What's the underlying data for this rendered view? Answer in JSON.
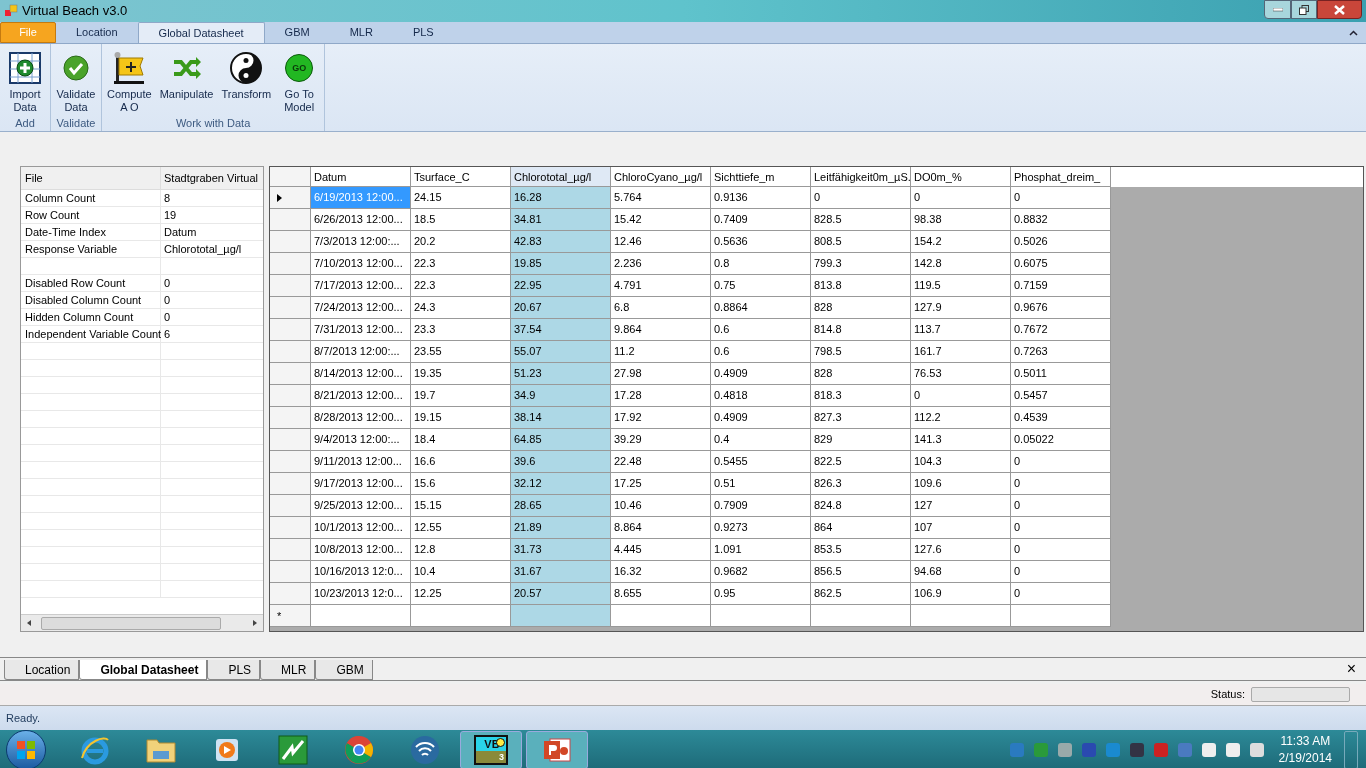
{
  "window": {
    "title": "Virtual Beach v3.0"
  },
  "ribbon_tabs": [
    {
      "label": "File",
      "kind": "file",
      "selected": false
    },
    {
      "label": "Location",
      "kind": "tab",
      "selected": false
    },
    {
      "label": "Global Datasheet",
      "kind": "tab",
      "selected": true
    },
    {
      "label": "GBM",
      "kind": "tab",
      "selected": false
    },
    {
      "label": "MLR",
      "kind": "tab",
      "selected": false
    },
    {
      "label": "PLS",
      "kind": "tab",
      "selected": false
    }
  ],
  "ribbon_groups": [
    {
      "label": "Add",
      "buttons": [
        {
          "label": "Import\nData",
          "kind": "import"
        }
      ]
    },
    {
      "label": "Validate",
      "buttons": [
        {
          "label": "Validate\nData",
          "kind": "validate"
        }
      ]
    },
    {
      "label": "Work with Data",
      "buttons": [
        {
          "label": "Compute\nA O",
          "kind": "compute"
        },
        {
          "label": "Manipulate",
          "kind": "shuffle"
        },
        {
          "label": "Transform",
          "kind": "yinyang"
        },
        {
          "label": "Go To\nModel",
          "kind": "go",
          "icon_text": "GO"
        }
      ]
    }
  ],
  "properties": {
    "header": [
      "File",
      "Stadtgraben Virtual"
    ],
    "rows": [
      [
        "Column Count",
        "8"
      ],
      [
        "Row Count",
        "19"
      ],
      [
        "Date-Time Index",
        "Datum"
      ],
      [
        "Response Variable",
        "Chlorototal_µg/l"
      ],
      [],
      [
        "Disabled Row Count",
        "0"
      ],
      [
        "Disabled Column Count",
        "0"
      ],
      [
        "Hidden Column Count",
        "0"
      ],
      [
        "Independent Variable Count",
        "6"
      ]
    ]
  },
  "table": {
    "columns": [
      {
        "label": "Datum",
        "selected": false
      },
      {
        "label": "Tsurface_C",
        "selected": false
      },
      {
        "label": "Chlorototal_µg/l",
        "selected": true
      },
      {
        "label": "ChloroCyano_µg/l",
        "selected": false
      },
      {
        "label": "Sichttiefe_m",
        "selected": false
      },
      {
        "label": "Leitfähigkeit0m_µS.",
        "selected": false
      },
      {
        "label": "DO0m_%",
        "selected": false
      },
      {
        "label": "Phosphat_dreim_",
        "selected": false
      }
    ],
    "rows": [
      {
        "current": true,
        "cells": [
          "6/19/2013 12:00...",
          "24.15",
          "16.28",
          "5.764",
          "0.9136",
          "0",
          "0",
          "0"
        ],
        "date_selected": true
      },
      {
        "current": false,
        "cells": [
          "6/26/2013 12:00...",
          "18.5",
          "34.81",
          "15.42",
          "0.7409",
          "828.5",
          "98.38",
          "0.8832"
        ]
      },
      {
        "current": false,
        "cells": [
          "7/3/2013 12:00:...",
          "20.2",
          "42.83",
          "12.46",
          "0.5636",
          "808.5",
          "154.2",
          "0.5026"
        ]
      },
      {
        "current": false,
        "cells": [
          "7/10/2013 12:00...",
          "22.3",
          "19.85",
          "2.236",
          "0.8",
          "799.3",
          "142.8",
          "0.6075"
        ]
      },
      {
        "current": false,
        "cells": [
          "7/17/2013 12:00...",
          "22.3",
          "22.95",
          "4.791",
          "0.75",
          "813.8",
          "119.5",
          "0.7159"
        ]
      },
      {
        "current": false,
        "cells": [
          "7/24/2013 12:00...",
          "24.3",
          "20.67",
          "6.8",
          "0.8864",
          "828",
          "127.9",
          "0.9676"
        ]
      },
      {
        "current": false,
        "cells": [
          "7/31/2013 12:00...",
          "23.3",
          "37.54",
          "9.864",
          "0.6",
          "814.8",
          "113.7",
          "0.7672"
        ]
      },
      {
        "current": false,
        "cells": [
          "8/7/2013 12:00:...",
          "23.55",
          "55.07",
          "11.2",
          "0.6",
          "798.5",
          "161.7",
          "0.7263"
        ]
      },
      {
        "current": false,
        "cells": [
          "8/14/2013 12:00...",
          "19.35",
          "51.23",
          "27.98",
          "0.4909",
          "828",
          "76.53",
          "0.5011"
        ]
      },
      {
        "current": false,
        "cells": [
          "8/21/2013 12:00...",
          "19.7",
          "34.9",
          "17.28",
          "0.4818",
          "818.3",
          "0",
          "0.5457"
        ]
      },
      {
        "current": false,
        "cells": [
          "8/28/2013 12:00...",
          "19.15",
          "38.14",
          "17.92",
          "0.4909",
          "827.3",
          "112.2",
          "0.4539"
        ]
      },
      {
        "current": false,
        "cells": [
          "9/4/2013 12:00:...",
          "18.4",
          "64.85",
          "39.29",
          "0.4",
          "829",
          "141.3",
          "0.05022"
        ]
      },
      {
        "current": false,
        "cells": [
          "9/11/2013 12:00...",
          "16.6",
          "39.6",
          "22.48",
          "0.5455",
          "822.5",
          "104.3",
          "0"
        ]
      },
      {
        "current": false,
        "cells": [
          "9/17/2013 12:00...",
          "15.6",
          "32.12",
          "17.25",
          "0.51",
          "826.3",
          "109.6",
          "0"
        ]
      },
      {
        "current": false,
        "cells": [
          "9/25/2013 12:00...",
          "15.15",
          "28.65",
          "10.46",
          "0.7909",
          "824.8",
          "127",
          "0"
        ]
      },
      {
        "current": false,
        "cells": [
          "10/1/2013 12:00...",
          "12.55",
          "21.89",
          "8.864",
          "0.9273",
          "864",
          "107",
          "0"
        ]
      },
      {
        "current": false,
        "cells": [
          "10/8/2013 12:00...",
          "12.8",
          "31.73",
          "4.445",
          "1.091",
          "853.5",
          "127.6",
          "0"
        ]
      },
      {
        "current": false,
        "cells": [
          "10/16/2013 12:0...",
          "10.4",
          "31.67",
          "16.32",
          "0.9682",
          "856.5",
          "94.68",
          "0"
        ]
      },
      {
        "current": false,
        "cells": [
          "10/23/2013 12:0...",
          "12.25",
          "20.57",
          "8.655",
          "0.95",
          "862.5",
          "106.9",
          "0"
        ]
      }
    ],
    "new_row_marker": "*"
  },
  "doc_tabs": [
    {
      "label": "Location",
      "selected": false
    },
    {
      "label": "Global Datasheet",
      "selected": true
    },
    {
      "label": "PLS",
      "selected": false
    },
    {
      "label": "MLR",
      "selected": false
    },
    {
      "label": "GBM",
      "selected": false
    }
  ],
  "doc_close": "×",
  "status": {
    "label": "Status:",
    "level": 0
  },
  "status_bar": "Ready.",
  "taskbar": {
    "apps": [
      {
        "kind": "ie",
        "selected": false
      },
      {
        "kind": "folder",
        "selected": false
      },
      {
        "kind": "media",
        "selected": false
      },
      {
        "kind": "chart",
        "selected": false
      },
      {
        "kind": "chrome",
        "selected": false
      },
      {
        "kind": "wifi",
        "selected": false
      },
      {
        "kind": "vb",
        "selected": true,
        "icon_text": "VB",
        "icon_sub": "3"
      },
      {
        "kind": "ppt",
        "selected": true
      }
    ],
    "time": "11:33 AM",
    "date": "2/19/2014"
  }
}
